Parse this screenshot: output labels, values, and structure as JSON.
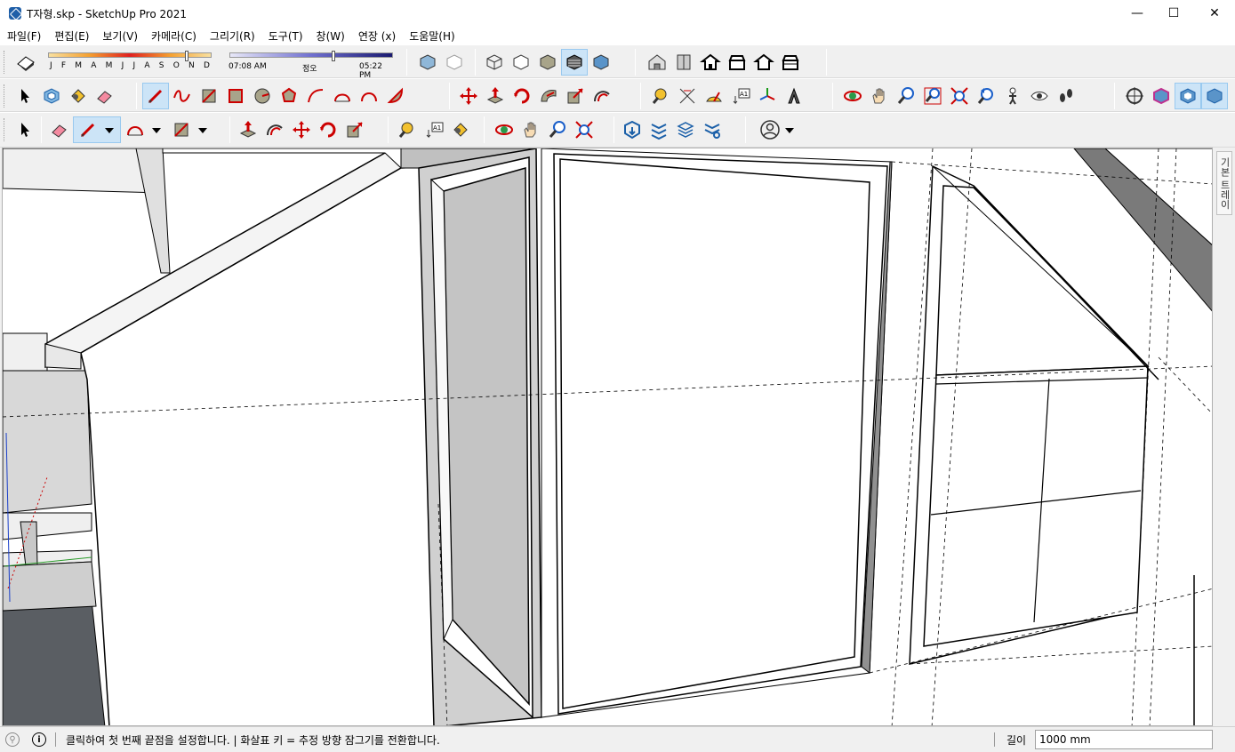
{
  "window": {
    "title": "T자형.skp - SketchUp Pro 2021",
    "minimize": "—",
    "maximize": "☐",
    "close": "✕"
  },
  "menu": [
    "파일(F)",
    "편집(E)",
    "보기(V)",
    "카메라(C)",
    "그리기(R)",
    "도구(T)",
    "창(W)",
    "연장 (x)",
    "도움말(H)"
  ],
  "shadows": {
    "months": [
      "J",
      "F",
      "M",
      "A",
      "M",
      "J",
      "J",
      "A",
      "S",
      "O",
      "N",
      "D"
    ],
    "time_start": "07:08 AM",
    "time_noon": "정오",
    "time_end": "05:22 PM"
  },
  "tray": {
    "tab_label": "기본 트레이"
  },
  "status": {
    "message": "클릭하여 첫 번째 끝점을 설정합니다. | 화살표 키 = 추정 방향 잠그기를 전환합니다.",
    "vcb_label": "길이",
    "vcb_value": "1000 mm"
  },
  "colors": {
    "accent_red": "#d42020",
    "accent_blue": "#2a6fc9",
    "active_bg": "#cce4f7"
  }
}
